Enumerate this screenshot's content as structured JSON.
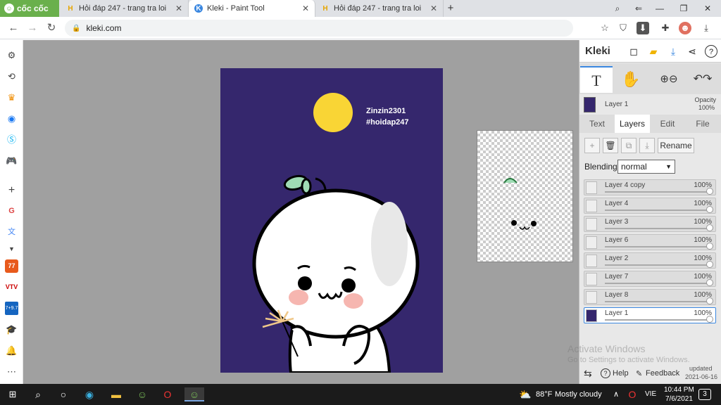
{
  "browser": {
    "brand_label": "cốc cốc",
    "tabs": [
      {
        "title": "Hỏi đáp 247 - trang tra loi",
        "icon": "H",
        "active": false
      },
      {
        "title": "Kleki - Paint Tool",
        "icon": "K",
        "active": true
      },
      {
        "title": "Hỏi đáp 247 - trang tra loi",
        "icon": "H",
        "active": false
      }
    ],
    "new_tab_symbol": "+",
    "url": "kleki.com"
  },
  "sidebar_icons": [
    "settings-icon",
    "history-icon",
    "crown-icon",
    "messenger-icon",
    "skype-icon",
    "gamepad-icon",
    "add-icon",
    "gmail-icon",
    "translate-icon",
    "chevron-down-icon",
    "news77-icon",
    "vtv-icon",
    "weather-icon",
    "graduation-icon",
    "bell-icon",
    "more-icon"
  ],
  "canvas": {
    "author_line1": "Zinzin2301",
    "author_line2": "#hoidap247"
  },
  "kleki": {
    "brand": "Kleki",
    "current_layer": "Layer 1",
    "opacity_label": "Opacity",
    "opacity_value": "100%",
    "tabs": [
      "Text",
      "Layers",
      "Edit",
      "File"
    ],
    "active_tab": "Layers",
    "rename_label": "Rename",
    "blending_label": "Blending",
    "blending_value": "normal",
    "layers": [
      {
        "name": "Layer 4 copy",
        "opacity": "100%",
        "level": 1.0
      },
      {
        "name": "Layer 4",
        "opacity": "100%",
        "level": 1.0
      },
      {
        "name": "Layer 3",
        "opacity": "100%",
        "level": 1.0
      },
      {
        "name": "Layer 6",
        "opacity": "100%",
        "level": 1.0
      },
      {
        "name": "Layer 2",
        "opacity": "100%",
        "level": 1.0
      },
      {
        "name": "Layer 7",
        "opacity": "100%",
        "level": 1.0
      },
      {
        "name": "Layer 8",
        "opacity": "100%",
        "level": 1.0
      },
      {
        "name": "Layer 1",
        "opacity": "100%",
        "level": 1.0,
        "selected": true
      }
    ],
    "help_label": "Help",
    "feedback_label": "Feedback",
    "updated_label": "updated",
    "updated_date": "2021-06-16"
  },
  "watermark": {
    "line1": "Activate Windows",
    "line2": "Go to Settings to activate Windows."
  },
  "taskbar": {
    "weather_temp": "88°F",
    "weather_desc": "Mostly cloudy",
    "lang": "VIE",
    "time": "10:44 PM",
    "date": "7/6/2021",
    "notifications": "3"
  },
  "colors": {
    "canvas_bg": "#35276d",
    "moon": "#f9d535",
    "accent": "#3a87e0",
    "cocco_green": "#6ab04c"
  }
}
